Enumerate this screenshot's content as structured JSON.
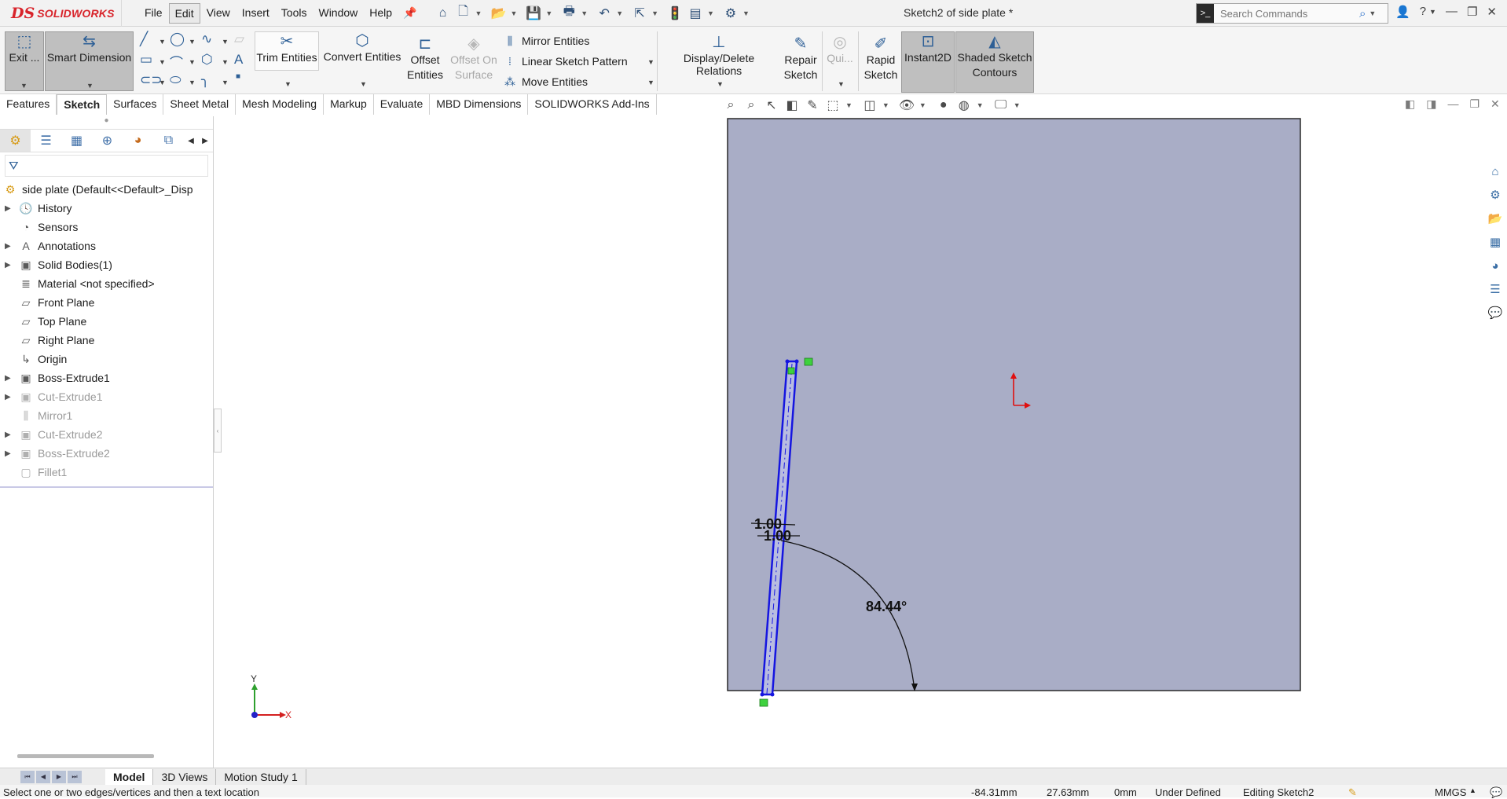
{
  "app": {
    "brand_ds": "DS",
    "brand_name": "SOLIDWORKS",
    "doc_title": "Sketch2 of side plate *"
  },
  "menu": [
    "File",
    "Edit",
    "View",
    "Insert",
    "Tools",
    "Window",
    "Help"
  ],
  "active_menu": "Edit",
  "search": {
    "placeholder": "Search Commands"
  },
  "commands": {
    "exit_sketch": "Exit ...",
    "smart_dimension": "Smart Dimension",
    "trim_entities": "Trim Entities",
    "convert_entities": "Convert Entities",
    "offset_entities_1": "Offset",
    "offset_entities_2": "Entities",
    "offset_on_surface_1": "Offset On",
    "offset_on_surface_2": "Surface",
    "mirror_entities": "Mirror Entities",
    "linear_sketch_pattern": "Linear Sketch Pattern",
    "move_entities": "Move Entities",
    "display_delete_relations": "Display/Delete Relations",
    "repair_sketch_1": "Repair",
    "repair_sketch_2": "Sketch",
    "quick_snaps": "Qui...",
    "rapid_sketch_1": "Rapid",
    "rapid_sketch_2": "Sketch",
    "instant2d": "Instant2D",
    "shaded_contours_1": "Shaded Sketch",
    "shaded_contours_2": "Contours"
  },
  "tabs": [
    "Features",
    "Sketch",
    "Surfaces",
    "Sheet Metal",
    "Mesh Modeling",
    "Markup",
    "Evaluate",
    "MBD Dimensions",
    "SOLIDWORKS Add-Ins"
  ],
  "active_tab": "Sketch",
  "tree": {
    "root": "side plate  (Default<<Default>_Disp",
    "items": [
      {
        "label": "History",
        "icon": "history-icon",
        "expand": true,
        "suppressed": false
      },
      {
        "label": "Sensors",
        "icon": "sensors-icon",
        "expand": false,
        "suppressed": false
      },
      {
        "label": "Annotations",
        "icon": "annotations-icon",
        "expand": true,
        "suppressed": false
      },
      {
        "label": "Solid Bodies(1)",
        "icon": "solid-bodies-icon",
        "expand": true,
        "suppressed": false
      },
      {
        "label": "Material <not specified>",
        "icon": "material-icon",
        "expand": false,
        "suppressed": false
      },
      {
        "label": "Front Plane",
        "icon": "plane-icon",
        "expand": false,
        "suppressed": false
      },
      {
        "label": "Top Plane",
        "icon": "plane-icon",
        "expand": false,
        "suppressed": false
      },
      {
        "label": "Right Plane",
        "icon": "plane-icon",
        "expand": false,
        "suppressed": false
      },
      {
        "label": "Origin",
        "icon": "origin-icon",
        "expand": false,
        "suppressed": false
      },
      {
        "label": "Boss-Extrude1",
        "icon": "extrude-icon",
        "expand": true,
        "suppressed": false
      },
      {
        "label": "Cut-Extrude1",
        "icon": "cut-extrude-icon",
        "expand": true,
        "suppressed": true
      },
      {
        "label": "Mirror1",
        "icon": "mirror-icon",
        "expand": false,
        "suppressed": true
      },
      {
        "label": "Cut-Extrude2",
        "icon": "cut-extrude-icon",
        "expand": true,
        "suppressed": true
      },
      {
        "label": "Boss-Extrude2",
        "icon": "extrude-icon",
        "expand": true,
        "suppressed": true
      },
      {
        "label": "Fillet1",
        "icon": "fillet-icon",
        "expand": false,
        "suppressed": true
      }
    ]
  },
  "bottom_tabs": [
    "Model",
    "3D Views",
    "Motion Study 1"
  ],
  "active_bottom_tab": "Model",
  "status": {
    "message": "Select one or two edges/vertices and then a text location",
    "x": "-84.31mm",
    "y": "27.63mm",
    "z": "0mm",
    "definition": "Under Defined",
    "editing": "Editing Sketch2",
    "units": "MMGS"
  },
  "sketch": {
    "dim_top": "1.00",
    "dim_bottom": "1.00",
    "dim_angle": "84.44°",
    "triad_y": "Y",
    "triad_x": "X",
    "plate_color": "#a9adc6",
    "sketch_color": "#1515e0"
  }
}
